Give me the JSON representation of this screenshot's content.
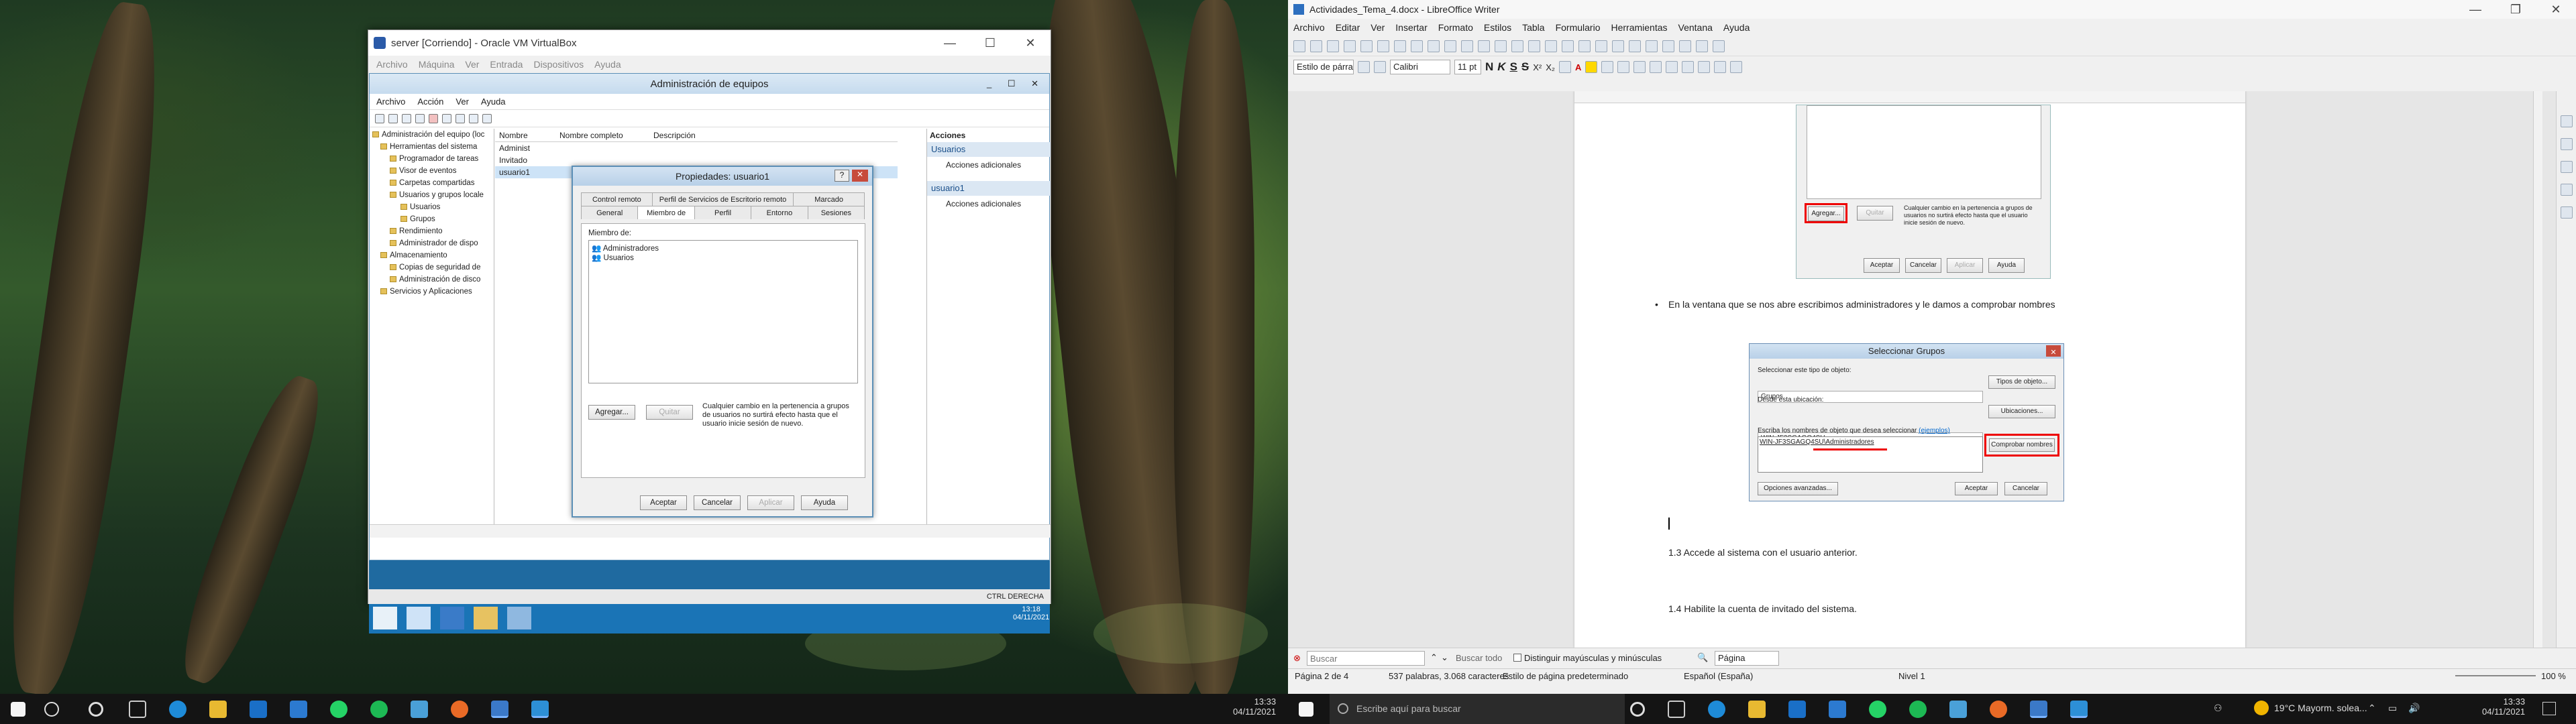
{
  "colors": {
    "accent": "#1a74b6",
    "highlight_red": "#e00000",
    "taskbar": "#141414"
  },
  "vbox": {
    "title": "server [Corriendo] - Oracle VM VirtualBox",
    "menu": [
      "Archivo",
      "Máquina",
      "Ver",
      "Entrada",
      "Dispositivos",
      "Ayuda"
    ]
  },
  "mgmt": {
    "title": "Administración de equipos",
    "menu": [
      "Archivo",
      "Acción",
      "Ver",
      "Ayuda"
    ],
    "tree": [
      "Administración del equipo (loc",
      "Herramientas del sistema",
      "Programador de tareas",
      "Visor de eventos",
      "Carpetas compartidas",
      "Usuarios y grupos locale",
      "Usuarios",
      "Grupos",
      "Rendimiento",
      "Administrador de dispo",
      "Almacenamiento",
      "Copias de seguridad de",
      "Administración de disco",
      "Servicios y Aplicaciones"
    ],
    "list_header": [
      "Nombre",
      "Nombre completo",
      "Descripción"
    ],
    "list_rows": [
      "Administ",
      "Invitado",
      "usuario1"
    ],
    "actions_title": "Acciones",
    "actions": [
      {
        "head": "Usuarios",
        "item": "Acciones adicionales"
      },
      {
        "head": "usuario1",
        "item": "Acciones adicionales"
      }
    ]
  },
  "props": {
    "title": "Propiedades: usuario1",
    "tabs_row1": [
      "Control remoto",
      "Perfil de Servicios de Escritorio remoto",
      "Marcado"
    ],
    "tabs_row2": [
      "General",
      "Miembro de",
      "Perfil",
      "Entorno",
      "Sesiones"
    ],
    "member_of_label": "Miembro de:",
    "members": [
      "Administradores",
      "Usuarios"
    ],
    "add": "Agregar...",
    "remove": "Quitar",
    "note": "Cualquier cambio en la pertenencia a grupos de usuarios no surtirá efecto hasta que el usuario inicie sesión de nuevo.",
    "ok": "Aceptar",
    "cancel": "Cancelar",
    "apply": "Aplicar",
    "help": "Ayuda"
  },
  "guest_clock": {
    "time": "13:18",
    "date": "04/11/2021"
  },
  "guest_status": "CTRL DERECHA",
  "writer": {
    "title": "Actividades_Tema_4.docx - LibreOffice Writer",
    "menu": [
      "Archivo",
      "Editar",
      "Ver",
      "Insertar",
      "Formato",
      "Estilos",
      "Tabla",
      "Formulario",
      "Herramientas",
      "Ventana",
      "Ayuda"
    ],
    "para_style": "Estilo de párrafo predet",
    "font": "Calibri",
    "size": "11 pt",
    "embedded_buttons": {
      "add": "Agregar...",
      "remove": "Quitar",
      "note": "Cualquier cambio en la pertenencia a grupos de usuarios no surtirá efecto hasta que el usuario inicie sesión de nuevo.",
      "ok": "Aceptar",
      "cancel": "Cancelar",
      "apply": "Aplicar",
      "help": "Ayuda"
    },
    "bullet": "En la ventana que se nos abre escribimos administradores y le damos a comprobar nombres",
    "select_groups": {
      "title": "Seleccionar Grupos",
      "type_label": "Seleccionar este tipo de objeto:",
      "type_value": "Grupos",
      "type_btn": "Tipos de objeto...",
      "loc_label": "Desde esta ubicación:",
      "loc_value": "WIN-JF3SGAGQ4SU",
      "loc_btn": "Ubicaciones...",
      "names_label": "Escriba los nombres de objeto que desea seleccionar",
      "examples": "(ejemplos)",
      "names_value": "WIN-JF3SGAGQ4SU\\Administradores",
      "check_btn": "Comprobar nombres",
      "adv_btn": "Opciones avanzadas...",
      "ok": "Aceptar",
      "cancel": "Cancelar"
    },
    "line13": "1.3 Accede al sistema con el usuario anterior.",
    "line14": "1.4 Habilite la cuenta de invitado del sistema.",
    "find_placeholder": "Buscar",
    "find_all": "Buscar todo",
    "match_case": "Distinguir mayúsculas y minúsculas",
    "find_page": "Página",
    "status": {
      "page": "Página 2 de 4",
      "words": "537 palabras, 3.068 caracteres",
      "style": "Estilo de página predeterminado",
      "lang": "Español (España)",
      "level": "Nivel 1",
      "zoom": "100 %"
    }
  },
  "taskbar": {
    "search_placeholder": "Escribe aquí para buscar",
    "left_time": "13:33",
    "left_date": "04/11/2021",
    "weather": "19°C  Mayorm. solea...",
    "time": "13:33",
    "date": "04/11/2021"
  }
}
